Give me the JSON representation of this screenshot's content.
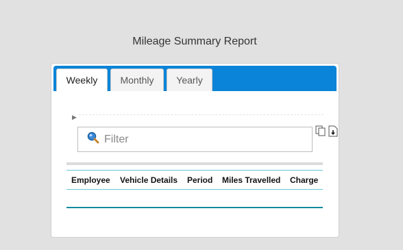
{
  "page": {
    "title": "Mileage Summary Report"
  },
  "tabs": [
    {
      "label": "Weekly",
      "active": true
    },
    {
      "label": "Monthly",
      "active": false
    },
    {
      "label": "Yearly",
      "active": false
    }
  ],
  "toolbar": {
    "expander_icon": "triangle-right-icon",
    "filter_placeholder": "Filter",
    "filter_value": "",
    "search_icon": "magnifier-icon",
    "copy_icon": "copy-icon",
    "download_icon": "download-icon"
  },
  "table": {
    "columns": [
      "Employee",
      "Vehicle Details",
      "Period",
      "Miles Travelled",
      "Charge"
    ],
    "rows": []
  },
  "colors": {
    "tab_bar": "#0a84d8",
    "header_border": "#63c7d8",
    "table_bottom_border": "#128a9e"
  }
}
